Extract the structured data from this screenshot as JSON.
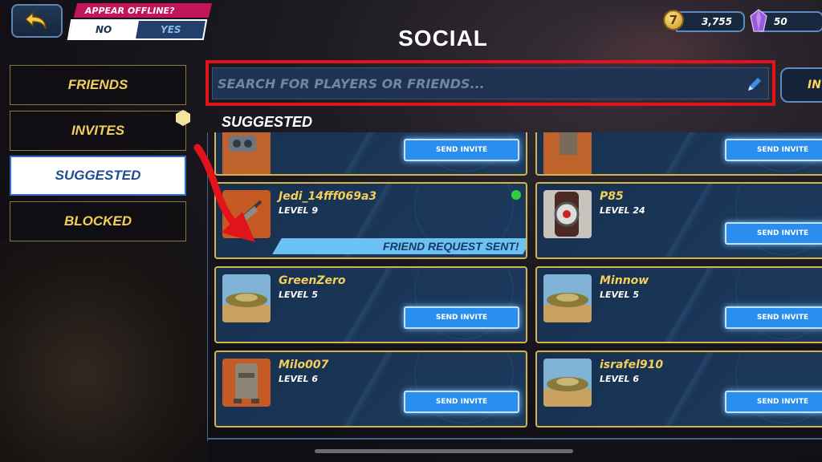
{
  "header": {
    "title": "SOCIAL",
    "appear_offline_label": "APPEAR OFFLINE?",
    "toggle_no": "NO",
    "toggle_yes": "YES",
    "coins": "3,755",
    "coin_symbol": "7",
    "gems": "50"
  },
  "search": {
    "placeholder": "SEARCH FOR PLAYERS OR FRIENDS...",
    "side_button_partial": "IN"
  },
  "sidebar": {
    "items": [
      {
        "label": "FRIENDS"
      },
      {
        "label": "INVITES"
      },
      {
        "label": "SUGGESTED"
      },
      {
        "label": "BLOCKED"
      }
    ]
  },
  "section_title": "SUGGESTED",
  "players": [
    {
      "name": "Jedi_14fff069a3",
      "level": "LEVEL 9",
      "status": "FRIEND REQUEST SENT!",
      "online": true,
      "avatar": "speeder-icon"
    },
    {
      "name": "P85",
      "level": "LEVEL 24",
      "button": "SEND INVITE",
      "avatar": "watch-icon"
    },
    {
      "name": "GreenZero",
      "level": "LEVEL 5",
      "button": "SEND INVITE",
      "avatar": "landspeeder-icon"
    },
    {
      "name": "Minnow",
      "level": "LEVEL 5",
      "button": "SEND INVITE",
      "avatar": "landspeeder-icon"
    },
    {
      "name": "Milo007",
      "level": "LEVEL 6",
      "button": "SEND INVITE",
      "avatar": "droid-icon"
    },
    {
      "name": "israfel910",
      "level": "LEVEL 6",
      "button": "SEND INVITE",
      "avatar": "landspeeder-icon"
    }
  ],
  "partial_row_button": "SEND INVITE",
  "colors": {
    "highlight": "#e0141a",
    "gold": "#f4cf5a",
    "button_blue": "#2a8ef0"
  }
}
